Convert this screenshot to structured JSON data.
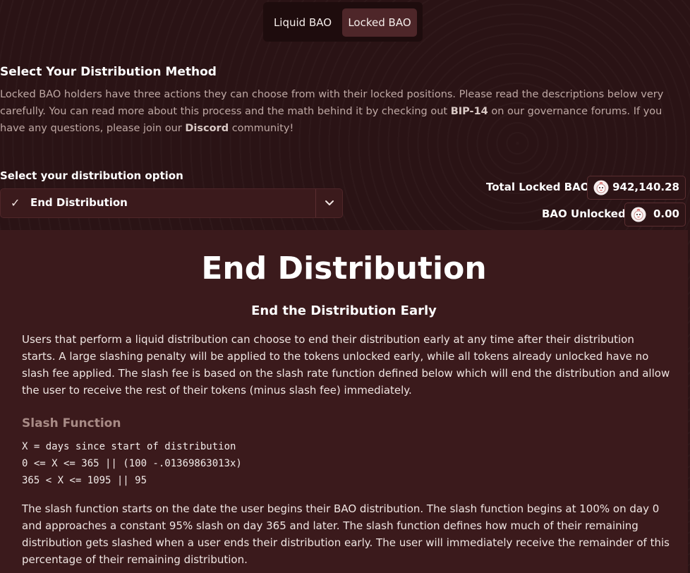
{
  "tabs": {
    "liquid": "Liquid BAO",
    "locked": "Locked BAO",
    "active": "Locked BAO"
  },
  "intro": {
    "heading": "Select Your Distribution Method",
    "text_1": "Locked BAO holders have three actions they can choose from with their locked positions. Please read the descriptions below very carefully. You can read more about this process and the math behind it by checking out ",
    "bip_link": "BIP-14",
    "text_2": " on our governance forums. If you have any questions, please join our ",
    "discord_link": "Discord",
    "text_3": " community!"
  },
  "selector": {
    "label": "Select your distribution option",
    "selected": "End Distribution"
  },
  "stats": {
    "total_locked_label": "Total Locked BAO",
    "total_locked_value": "942,140.28",
    "unlocked_label": "BAO Unlocked",
    "unlocked_value": "0.00"
  },
  "content": {
    "title": "End Distribution",
    "subtitle": "End the Distribution Early",
    "paragraph_1": "Users that perform a liquid distribution can choose to end their distribution early at any time after their distribution starts. A large slashing penalty will be applied to the tokens unlocked early, while all tokens already unlocked have no slash fee applied. The slash fee is based on the slash rate function defined below which will end the distribution and allow the user to receive the rest of their tokens (minus slash fee) immediately.",
    "slash_heading": "Slash Function",
    "code_lines": [
      "X = days since start of distribution",
      "0 <= X <= 365 || (100 -.01369863013x)",
      "365 < X <= 1095 || 95"
    ],
    "paragraph_2": "The slash function starts on the date the user begins their BAO distribution. The slash function begins at 100% on day 0 and approaches a constant 95% slash on day 365 and later. The slash function defines how much of their remaining distribution gets slashed when a user ends their distribution early. The user will immediately receive the remainder of this percentage of their remaining distribution."
  },
  "icons": {
    "check": "check-icon",
    "chevron": "chevron-down-icon",
    "coin": "bao-coin-icon"
  },
  "colors": {
    "background": "#2a1315",
    "panel": "#3b1a1c",
    "active_tab": "#4e2629"
  }
}
